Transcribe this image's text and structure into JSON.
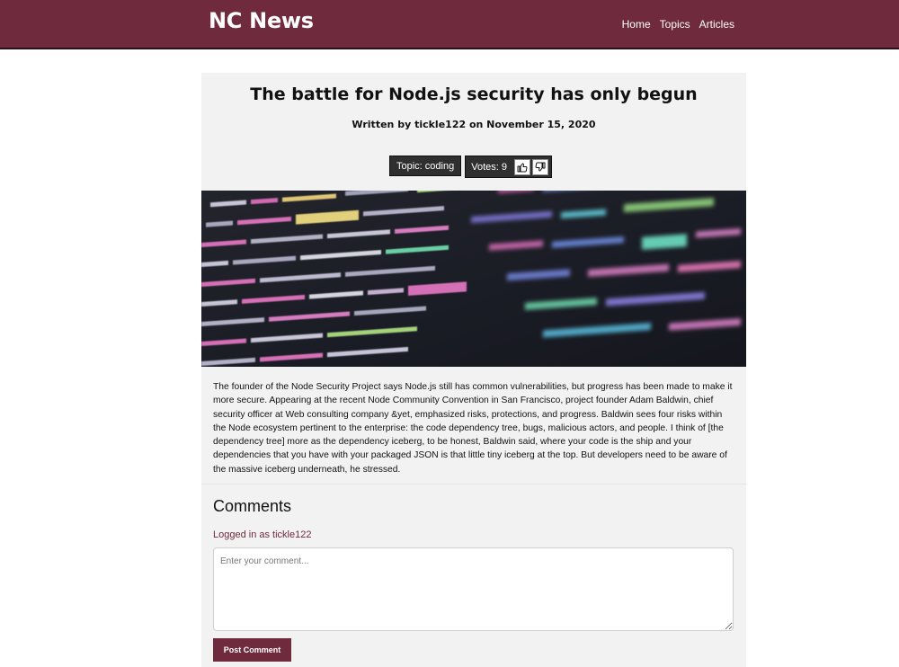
{
  "nav": {
    "brand": "NC News",
    "links": [
      {
        "label": "Home"
      },
      {
        "label": "Topics"
      },
      {
        "label": "Articles"
      }
    ]
  },
  "article": {
    "title": "The battle for Node.js security has only begun",
    "byline": "Written by tickle122 on November 15, 2020",
    "topic_label": "Topic: coding",
    "votes_label": "Votes: 9",
    "upvote_icon": "thumbs-up-icon",
    "downvote_icon": "thumbs-down-icon",
    "body": "The founder of the Node Security Project says Node.js still has common vulnerabilities, but progress has been made to make it more secure. Appearing at the recent Node Community Convention in San Francisco, project founder Adam Baldwin, chief security officer at Web consulting company &yet, emphasized risks, protections, and progress. Baldwin sees four risks within the Node ecosystem pertinent to the enterprise: the code dependency tree, bugs, malicious actors, and people. I think of [the dependency tree] more as the dependency iceberg, to be honest, Baldwin said, where your code is the ship and your dependencies that you have with your packaged JSON is that little tiny iceberg at the top. But developers need to be aware of the massive iceberg underneath, he stressed."
  },
  "comments": {
    "heading": "Comments",
    "logged_in": "Logged in as tickle122",
    "input_placeholder": "Enter your comment...",
    "input_value": "",
    "submit_label": "Post Comment"
  },
  "colors": {
    "brand": "#6f2a3e",
    "badge": "#2f2f2f",
    "panel": "#f2f2f2"
  }
}
